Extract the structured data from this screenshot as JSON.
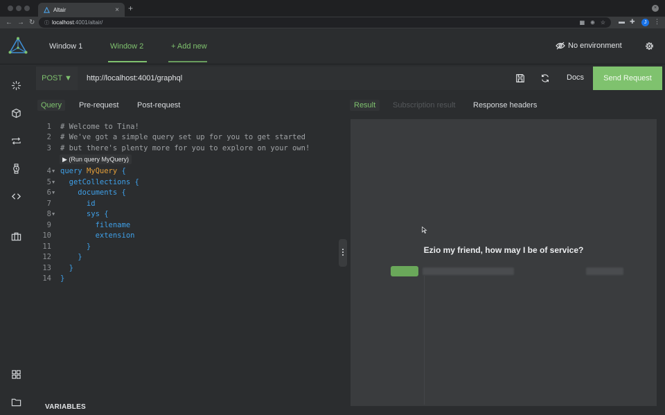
{
  "browser": {
    "tab_title": "Altair",
    "new_tab": "+",
    "url_host": "localhost",
    "url_path": ":4001/altair/",
    "profile_initial": "J"
  },
  "app": {
    "windows": [
      {
        "label": "Window 1",
        "active": false
      },
      {
        "label": "Window 2",
        "active": true
      }
    ],
    "add_new": "+ Add new",
    "environment": "No environment"
  },
  "request": {
    "method": "POST ▼",
    "url": "http://localhost:4001/graphql",
    "docs": "Docs",
    "send": "Send Request"
  },
  "query_tabs": [
    "Query",
    "Pre-request",
    "Post-request"
  ],
  "result_tabs": [
    "Result",
    "Subscription result",
    "Response headers"
  ],
  "editor": {
    "run_button": "(Run query MyQuery)",
    "lines": [
      {
        "n": "1",
        "text": "# Welcome to Tina!"
      },
      {
        "n": "2",
        "text": "# We've got a simple query set up for you to get started"
      },
      {
        "n": "3",
        "text": "# but there's plenty more for you to explore on your own!"
      },
      {
        "n": "4",
        "kw": "query",
        "name": "MyQuery",
        "br": " {"
      },
      {
        "n": "5",
        "text": "  getCollections {"
      },
      {
        "n": "6",
        "text": "    documents {"
      },
      {
        "n": "7",
        "text": "      id"
      },
      {
        "n": "8",
        "text": "      sys {"
      },
      {
        "n": "9",
        "text": "        filename"
      },
      {
        "n": "10",
        "text": "        extension"
      },
      {
        "n": "11",
        "text": "      }"
      },
      {
        "n": "12",
        "text": "    }"
      },
      {
        "n": "13",
        "text": "  }"
      },
      {
        "n": "14",
        "text": "}"
      }
    ]
  },
  "variables_label": "VARIABLES",
  "result": {
    "greeting": "Ezio my friend, how may I be of service?"
  },
  "colors": {
    "accent": "#7fc26e",
    "keyword": "#3fa0e8",
    "query_name": "#e5a03a"
  }
}
